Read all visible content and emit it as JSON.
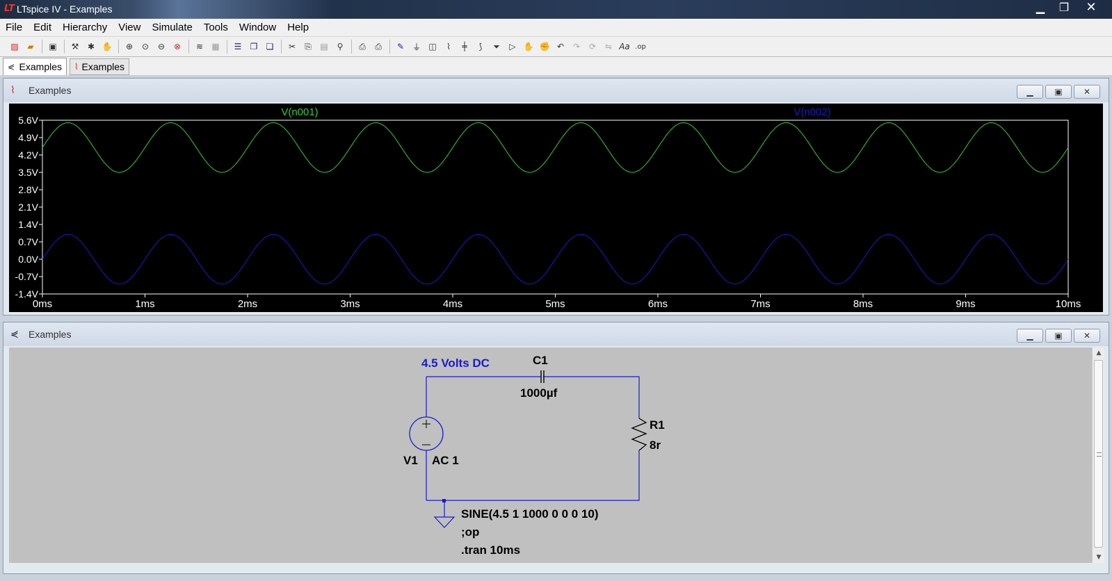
{
  "window": {
    "title": "LTspice IV - Examples",
    "app_icon": "ltspice-logo-icon"
  },
  "menu": [
    "File",
    "Edit",
    "Hierarchy",
    "View",
    "Simulate",
    "Tools",
    "Window",
    "Help"
  ],
  "toolbar_icons": [
    "new-schematic-icon",
    "open-icon",
    "save-icon",
    "control-panel-icon",
    "run-icon",
    "halt-icon",
    "zoom-in-icon",
    "zoom-pan-icon",
    "zoom-out-icon",
    "zoom-full-icon",
    "autorange-icon",
    "view-grid-icon",
    "tile-horizontal-icon",
    "cascade-icon",
    "tile-vertical-icon",
    "cut-icon",
    "copy-icon",
    "paste-icon",
    "find-icon",
    "print-preview-icon",
    "print-icon",
    "draw-wire-icon",
    "ground-icon",
    "label-net-icon",
    "resistor-icon",
    "capacitor-icon",
    "inductor-icon",
    "diode-icon",
    "component-icon",
    "move-icon",
    "drag-icon",
    "undo-icon",
    "redo-icon",
    "rotate-icon",
    "mirror-icon",
    "text-icon",
    "spice-directive-icon"
  ],
  "tabs": [
    {
      "label": "Examples",
      "icon": "schematic-icon",
      "active": true
    },
    {
      "label": "Examples",
      "icon": "waveform-icon",
      "active": false
    }
  ],
  "plot_window": {
    "title": "Examples",
    "icon": "waveform-icon",
    "buttons": {
      "minimize": "▁",
      "restore": "▣",
      "close": "✕"
    }
  },
  "schematic_window": {
    "title": "Examples",
    "icon": "schematic-icon",
    "buttons": {
      "minimize": "▁",
      "restore": "▣",
      "close": "✕"
    },
    "labels": {
      "net_label": "4.5 Volts DC",
      "cap_name": "C1",
      "cap_value": "1000µf",
      "res_name": "R1",
      "res_value": "8r",
      "src_name": "V1",
      "src_value": "AC 1",
      "src_sine": "SINE(4.5 1 1000 0 0 0 10)",
      "directive_op": ";op",
      "directive_tran": ".tran 10ms"
    }
  },
  "chart_data": {
    "type": "line",
    "x_ticks": [
      "0ms",
      "1ms",
      "2ms",
      "3ms",
      "4ms",
      "5ms",
      "6ms",
      "7ms",
      "8ms",
      "9ms",
      "10ms"
    ],
    "y_ticks": [
      "5.6V",
      "4.9V",
      "4.2V",
      "3.5V",
      "2.8V",
      "2.1V",
      "1.4V",
      "0.7V",
      "0.0V",
      "-0.7V",
      "-1.4V"
    ],
    "xlim": [
      0,
      10
    ],
    "ylim": [
      -1.4,
      5.6
    ],
    "x_unit": "ms",
    "series": [
      {
        "name": "V(n001)",
        "color": "#2fd12f",
        "offset": 4.5,
        "amplitude": 1.0,
        "freq_per_ms": 1.0,
        "phase": 0
      },
      {
        "name": "V(n002)",
        "color": "#1a1acc",
        "offset": 0.0,
        "amplitude": 1.0,
        "freq_per_ms": 1.0,
        "phase": 0
      }
    ],
    "background": "#000000",
    "axis_color": "#ffffff"
  }
}
